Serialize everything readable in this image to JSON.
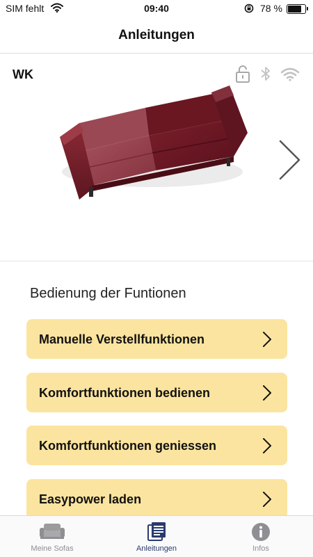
{
  "status_bar": {
    "carrier": "SIM fehlt",
    "time": "09:40",
    "battery_percent": "78 %",
    "battery_level": 0.78
  },
  "nav": {
    "title": "Anleitungen"
  },
  "sofa": {
    "name": "WK",
    "icons": [
      "lock-open-icon",
      "bluetooth-icon",
      "wifi-icon"
    ],
    "color": "#6b1c27"
  },
  "section": {
    "title": "Bedienung der Funtionen"
  },
  "menu": [
    {
      "label": "Manuelle Verstellfunktionen"
    },
    {
      "label": "Komfortfunktionen bedienen"
    },
    {
      "label": "Komfortfunktionen geniessen"
    },
    {
      "label": "Easypower laden"
    }
  ],
  "tabs": [
    {
      "label": "Meine Sofas",
      "icon": "sofa-icon",
      "active": false
    },
    {
      "label": "Anleitungen",
      "icon": "manual-icon",
      "active": true
    },
    {
      "label": "Infos",
      "icon": "info-icon",
      "active": false
    }
  ],
  "colors": {
    "button_bg": "#fbe49f",
    "active_tab": "#2a3a6e",
    "inactive_tab": "#8e8e93"
  }
}
